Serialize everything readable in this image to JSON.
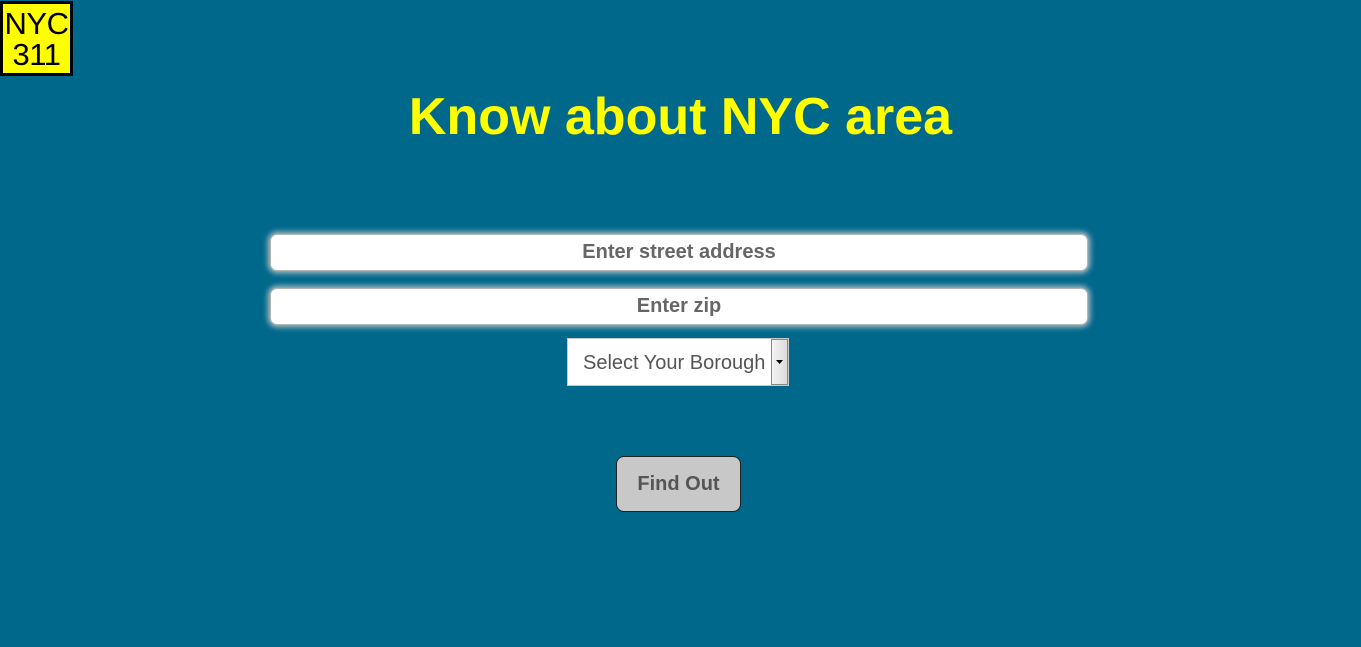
{
  "logo": {
    "line1": "NYC",
    "line2": "311"
  },
  "page_title": "Know about NYC area",
  "form": {
    "street_placeholder": "Enter street address",
    "zip_placeholder": "Enter zip",
    "borough_select": {
      "selected": "Select Your Borough",
      "arrow_icon": "chevron-down-icon"
    },
    "submit_label": "Find Out"
  },
  "colors": {
    "background": "#00688b",
    "title": "#ffff00",
    "logo_background": "#ffff00",
    "button_background": "#c8c8c8"
  }
}
